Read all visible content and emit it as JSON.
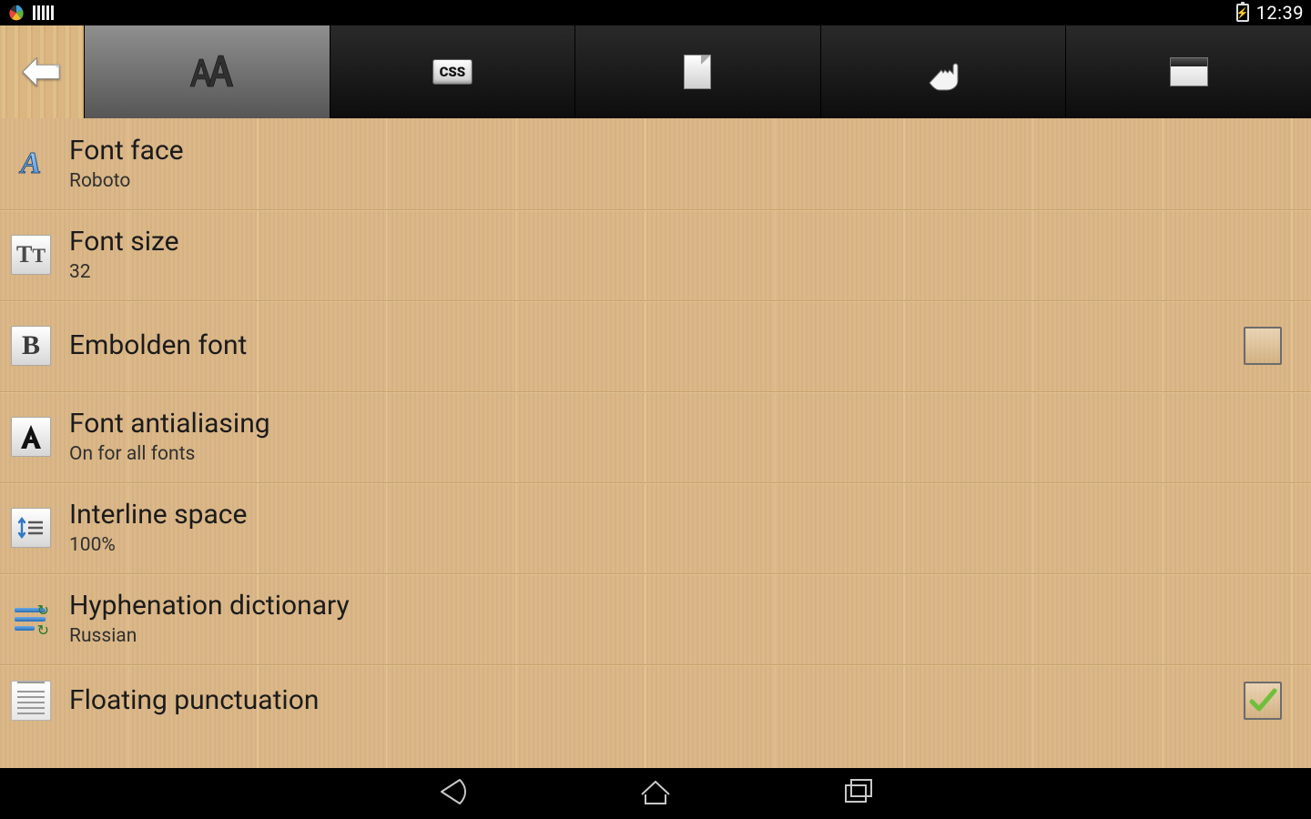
{
  "status": {
    "time": "12:39"
  },
  "tabs": {
    "css_label": "CSS"
  },
  "settings": [
    {
      "title": "Font face",
      "subtitle": "Roboto"
    },
    {
      "title": "Font size",
      "subtitle": "32"
    },
    {
      "title": "Embolden font",
      "subtitle": null,
      "checkbox": true,
      "checked": false
    },
    {
      "title": "Font antialiasing",
      "subtitle": "On for all fonts"
    },
    {
      "title": "Interline space",
      "subtitle": "100%"
    },
    {
      "title": "Hyphenation dictionary",
      "subtitle": "Russian"
    },
    {
      "title": "Floating punctuation",
      "subtitle": null,
      "checkbox": true,
      "checked": true
    }
  ]
}
